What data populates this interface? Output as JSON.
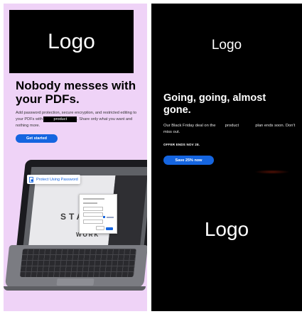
{
  "left_ad": {
    "logo": "Logo",
    "headline": "Nobody messes with your PDFs.",
    "body_before": "Add password protection, secure encryption, and restricted editing to your PDFs with",
    "product_redacted": "product",
    "body_after": ". Share only what you want and nothing more.",
    "cta_label": "Get started",
    "badge_label": "Protect Using Password",
    "screen_text_1": "STAT",
    "screen_text_2": "WORK"
  },
  "right_ad": {
    "logo_top": "Logo",
    "headline": "Going, going, almost gone.",
    "body_before": "Our Black Friday deal on the",
    "product": "product",
    "body_after": "plan ends soon. Don't miss out.",
    "offer": "OFFER ENDS NOV 28.",
    "cta_label": "Save 25% now",
    "logo_bottom": "Logo"
  },
  "colors": {
    "accent_blue": "#1565e0",
    "left_bg": "#efd3f7",
    "right_bg": "#000000"
  }
}
